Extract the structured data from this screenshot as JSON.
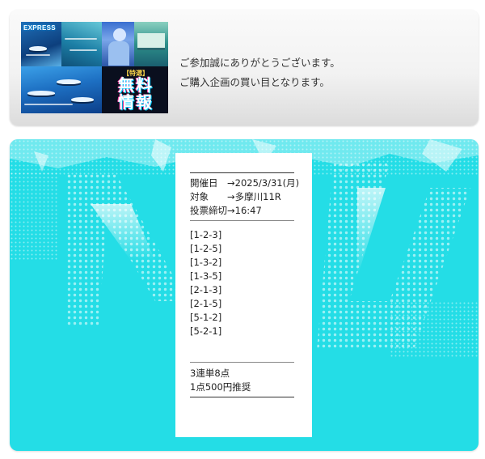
{
  "header": {
    "banner": {
      "logo": "EXPRESS",
      "tag": "【特選】",
      "title_line1": "無料",
      "title_line2": "情報"
    },
    "lines": [
      "ご参加誠にありがとうございます。",
      "ご購入企画の買い目となります。"
    ]
  },
  "ticket": {
    "rows": [
      {
        "label": "開催日",
        "value": "　→2025/3/31(月)"
      },
      {
        "label": "対象",
        "value": "　　→多摩川11R"
      },
      {
        "label": "投票締切",
        "value": "→16:47"
      }
    ],
    "combinations": [
      "[1-2-3]",
      "[1-2-5]",
      "[1-3-2]",
      "[1-3-5]",
      "[2-1-3]",
      "[2-1-5]",
      "[5-1-2]",
      "[5-2-1]"
    ],
    "summary": [
      "3連単8点",
      "1点500円推奨"
    ]
  },
  "colors": {
    "section_bg": "#24dde6",
    "ticket_bg": "#ffffff"
  }
}
